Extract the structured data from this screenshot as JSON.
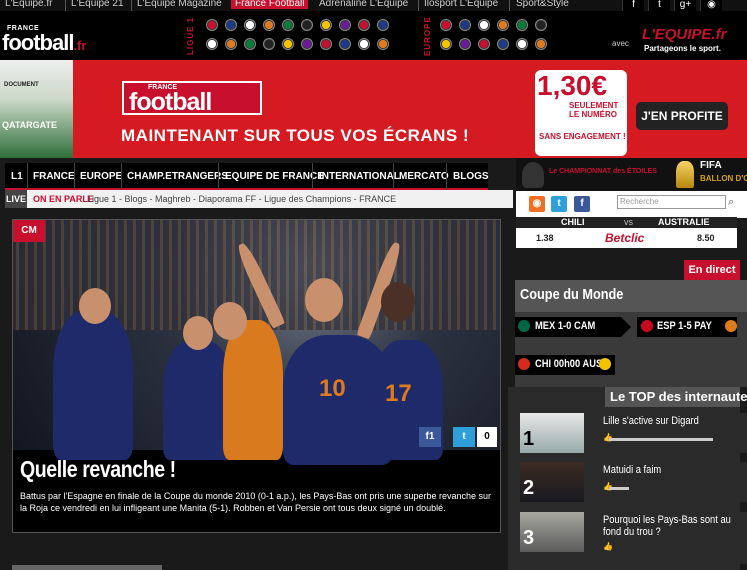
{
  "topnav": {
    "links": [
      "L'Equipe.fr",
      "L'Equipe 21",
      "L'Equipe Magazine",
      "France Football",
      "Adrenaline L'Equipe",
      "Ilosport L'Equipe",
      "Sport&Style"
    ],
    "active_index": 3,
    "social_icons": [
      "facebook-icon",
      "twitter-icon",
      "googleplus-icon",
      "rss-icon"
    ]
  },
  "header": {
    "logo_small": "FRANCE",
    "logo_big": "football",
    "logo_tld": ".fr",
    "ligue_label": "LIGUE 1",
    "europe_label": "EUROPE",
    "avec": "avec",
    "partner": "L'EQUIPE.fr",
    "partner_tagline": "Partageons le sport."
  },
  "ad": {
    "brand_small": "FRANCE",
    "brand_big": "football",
    "slogan": "MAINTENANT SUR TOUS VOS ÉCRANS !",
    "price": "1,30€",
    "price_note": "SEULEMENT LE NUMÉRO",
    "no_commitment": "SANS ENGAGEMENT !",
    "cta": "J'EN PROFITE",
    "mag_cover_text": "DOCUMENT",
    "mag_cover_text2": "QATARGATE"
  },
  "mainnav": {
    "items": [
      "L1",
      "FRANCE",
      "EUROPE",
      "CHAMP.ETRANGERS",
      "EQUIPE DE FRANCE",
      "INTERNATIONAL",
      "MERCATO",
      "BLOGS"
    ]
  },
  "onparle": {
    "live": "LIVE",
    "label": "ON EN PARLE :",
    "topics": "Ligue 1 - Blogs - Maghreb - Diaporama FF - Ligue des Champions - FRANCE"
  },
  "hero": {
    "tag": "CM",
    "title": "Quelle revanche !",
    "text": "Battus par l'Espagne en finale de la Coupe du monde 2010 (0-1 a.p.), les Pays-Bas ont pris une superbe revanche sur la Roja ce vendredi en lui infligeant une Manita (5-1). Robben et Van Persie ont tous deux signé un doublé.",
    "share_fb": "f",
    "share_fb_count": "1",
    "share_tw": "t",
    "share_count": "0",
    "jersey_left": "10",
    "jersey_right": "17"
  },
  "sidebar": {
    "championnat": "Le CHAMPIONNAT des ÉTOILES",
    "fifa": "FIFA",
    "ballon": "BALLON D'OR",
    "search_placeholder": "Recherche",
    "odds": {
      "home": "CHILI",
      "vs": "vs",
      "away": "AUSTRALIE",
      "home_odd": "1.38",
      "bookmaker": "Betclic",
      "away_odd": "8.50"
    },
    "en_direct": "En direct",
    "coupe": "Coupe du Monde",
    "matches": [
      "MEX 1-0 CAM",
      "ESP 1-5 PAY",
      "CHI 00h00 AUS"
    ],
    "top_title": "Le TOP des internautes",
    "top_items": [
      {
        "num": "1",
        "text": "Lille s'active sur Digard"
      },
      {
        "num": "2",
        "text": "Matuidi a faim"
      },
      {
        "num": "3",
        "text": "Pourquoi les Pays-Bas sont au fond du trou ?"
      }
    ]
  }
}
